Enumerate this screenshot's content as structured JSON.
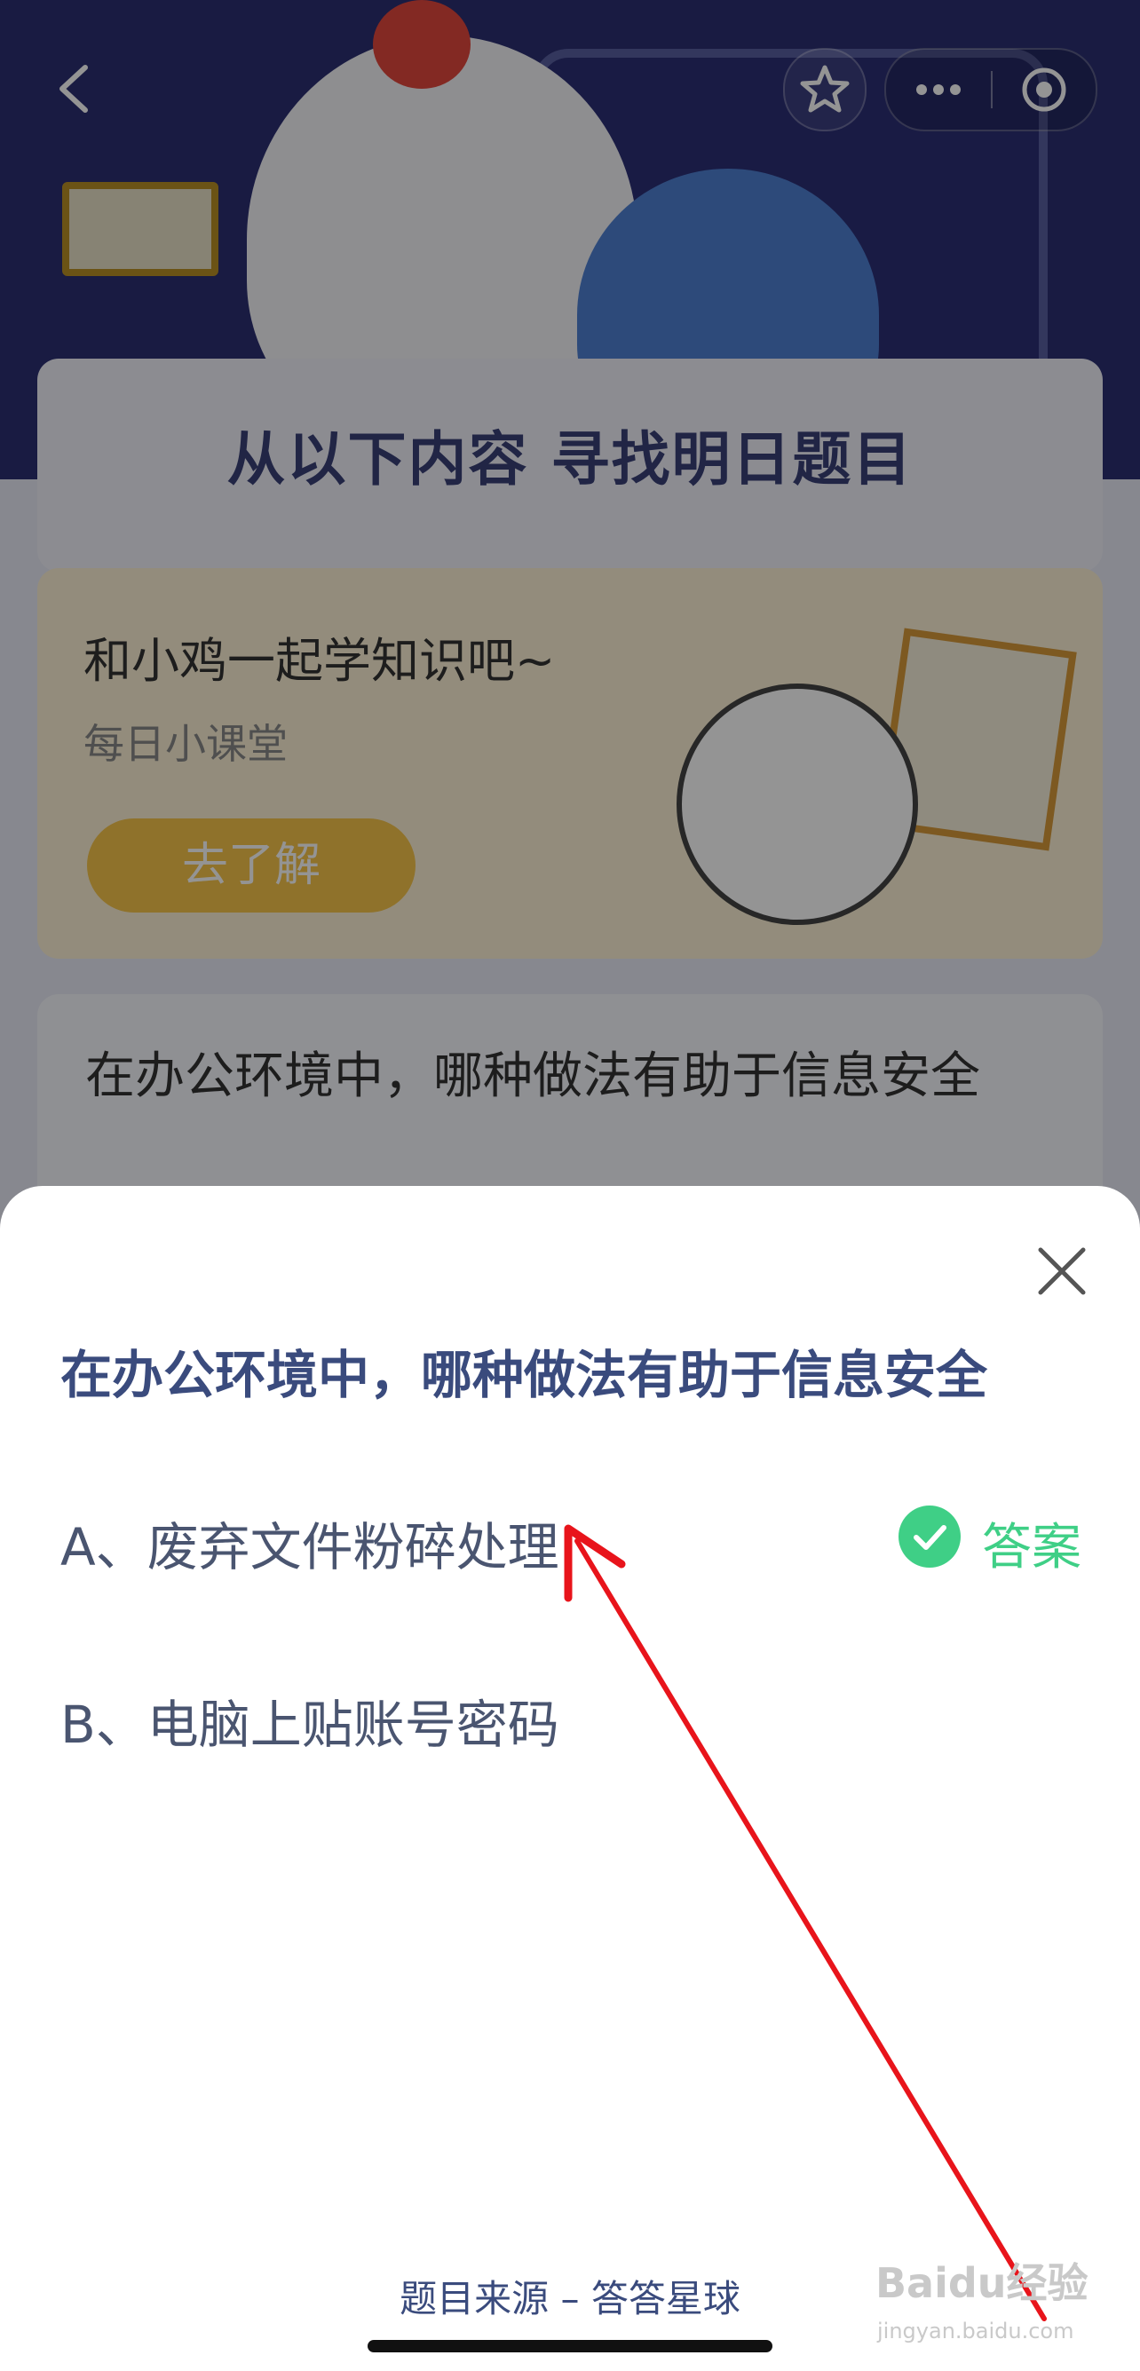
{
  "background": {
    "panel_title": "从以下内容 寻找明日题目",
    "promo": {
      "title": "和小鸡一起学知识吧~",
      "subtitle": "每日小课堂",
      "button": "去了解"
    },
    "question_card_text": "在办公环境中，哪种做法有助于信息安全"
  },
  "capsule_icons": {
    "back": "chevron-left-icon",
    "favorite": "star-icon",
    "more": "more-icon",
    "close": "target-icon"
  },
  "sheet": {
    "question": "在办公环境中，哪种做法有助于信息安全",
    "options": [
      {
        "text": "A、废弃文件粉碎处理",
        "is_answer": true
      },
      {
        "text": "B、电脑上贴账号密码",
        "is_answer": false
      }
    ],
    "answer_label": "答案",
    "source": "题目来源 – 答答星球"
  },
  "watermark": {
    "main": "Baidu经验",
    "sub": "jingyan.baidu.com"
  },
  "colors": {
    "accent_green": "#3fcf86",
    "question_blue": "#3a4b7d",
    "annotation_red": "#e8141b"
  }
}
